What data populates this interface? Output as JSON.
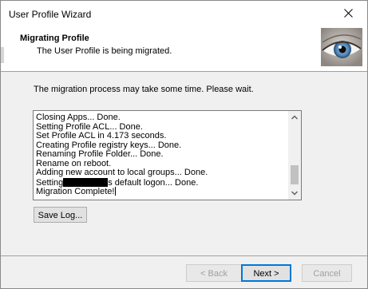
{
  "window": {
    "title": "User Profile Wizard",
    "close_icon": "close-icon"
  },
  "header": {
    "title": "Migrating Profile",
    "subtitle": "The User Profile is being migrated.",
    "logo_icon": "eye-icon"
  },
  "content": {
    "wait_message": "The migration process may take some time. Please wait.",
    "log": {
      "lines": [
        "Closing Apps... Done.",
        "Setting Profile ACL... Done.",
        "Set Profile ACL in 4.173 seconds.",
        "Creating Profile registry keys... Done.",
        "Renaming Profile Folder... Done.",
        "Rename on reboot.",
        "Adding new account to local groups... Done."
      ],
      "redacted_line_prefix": "Setting",
      "redacted_line_suffix": "s default logon... Done.",
      "last_line": "Migration Complete!",
      "scroll_position": 0.82
    },
    "save_log_label": "Save Log..."
  },
  "footer": {
    "back_label": "< Back",
    "next_label": "Next >",
    "cancel_label": "Cancel"
  }
}
